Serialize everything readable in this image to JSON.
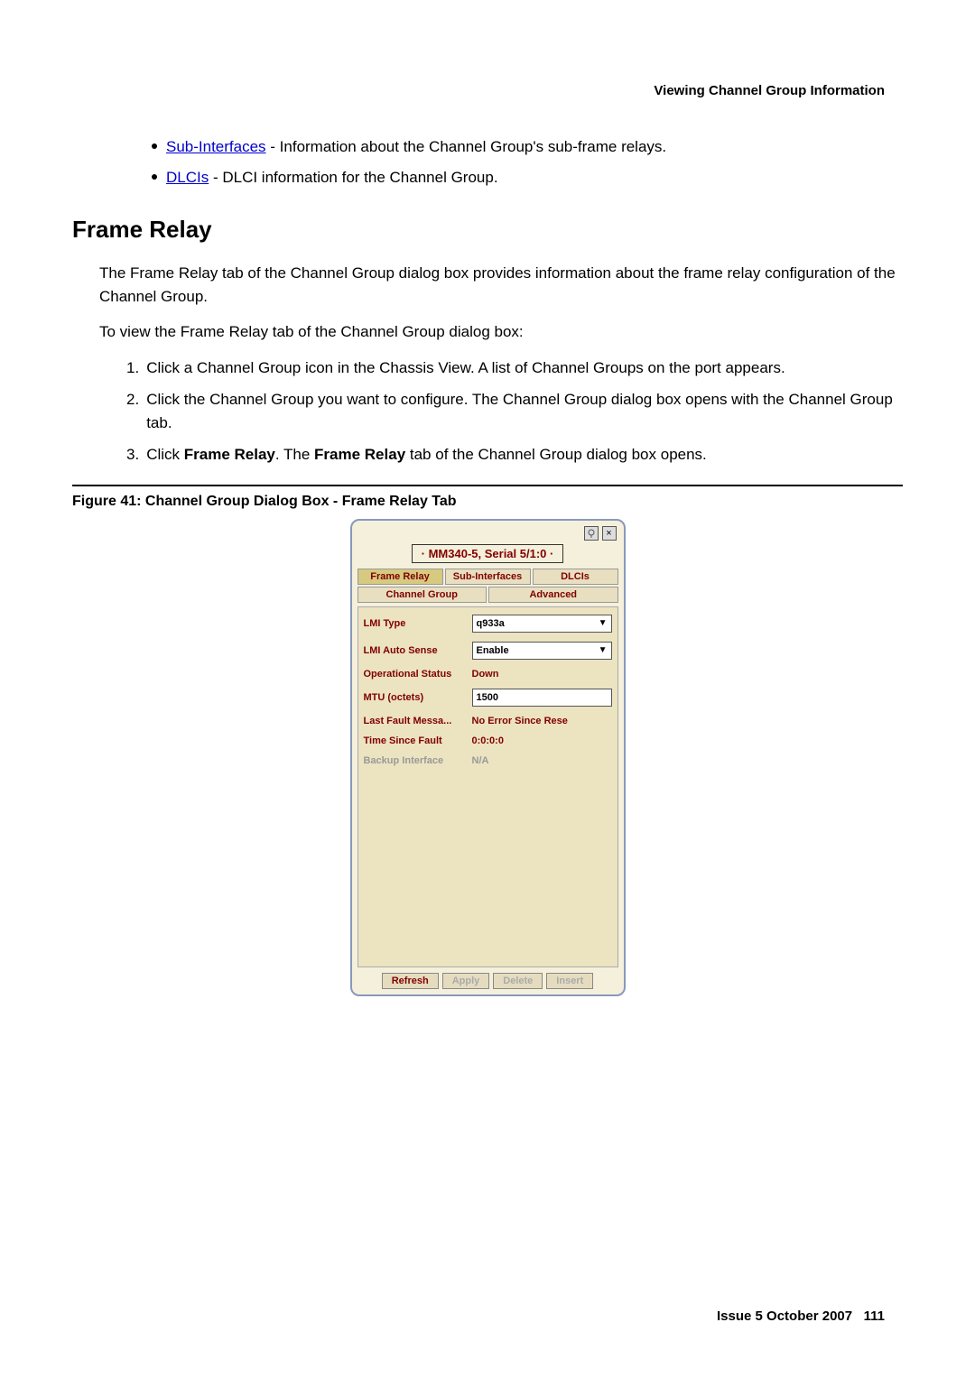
{
  "header": {
    "right_text": "Viewing Channel Group Information"
  },
  "bullets": {
    "sub_interfaces_link": "Sub-Interfaces",
    "sub_interfaces_text": " - Information about the Channel Group's sub-frame relays.",
    "dlcis_link": "DLCIs",
    "dlcis_text": " - DLCI information for the Channel Group."
  },
  "section": {
    "heading": "Frame Relay",
    "para1": "The Frame Relay tab of the Channel Group dialog box provides information about the frame relay configuration of the Channel Group.",
    "para2": "To view the Frame Relay tab of the Channel Group dialog box:",
    "steps": {
      "s1": "Click a Channel Group icon in the Chassis View. A list of Channel Groups on the port appears.",
      "s2": "Click the Channel Group you want to configure. The Channel Group dialog box opens with the Channel Group tab.",
      "s3a": "Click ",
      "s3b": "Frame Relay",
      "s3c": ". The ",
      "s3d": "Frame Relay",
      "s3e": " tab of the Channel Group dialog box opens."
    }
  },
  "figure": {
    "caption": "Figure 41: Channel Group Dialog Box - Frame Relay Tab"
  },
  "dialog": {
    "close_x": "×",
    "device_label": "· MM340-5, Serial 5/1:0 ·",
    "tabs": {
      "frame_relay": "Frame Relay",
      "sub_interfaces": "Sub-Interfaces",
      "dlcis": "DLCIs",
      "channel_group": "Channel Group",
      "advanced": "Advanced"
    },
    "fields": {
      "lmi_type_label": "LMI Type",
      "lmi_type_value": "q933a",
      "lmi_auto_sense_label": "LMI Auto Sense",
      "lmi_auto_sense_value": "Enable",
      "op_status_label": "Operational Status",
      "op_status_value": "Down",
      "mtu_label": "MTU (octets)",
      "mtu_value": "1500",
      "last_fault_label": "Last Fault Messa...",
      "last_fault_value": "No Error Since Rese",
      "time_since_fault_label": "Time Since Fault",
      "time_since_fault_value": "0:0:0:0",
      "backup_interface_label": "Backup Interface",
      "backup_interface_value": "N/A"
    },
    "buttons": {
      "refresh": "Refresh",
      "apply": "Apply",
      "delete": "Delete",
      "insert": "Insert"
    }
  },
  "footer": {
    "issue": "Issue 5   October 2007",
    "page": "111"
  }
}
